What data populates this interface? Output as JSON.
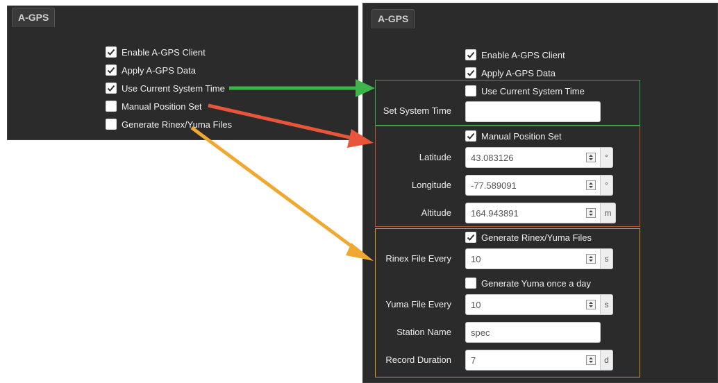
{
  "left_panel": {
    "tab": "A-GPS",
    "checkboxes": [
      {
        "label": "Enable A-GPS Client",
        "checked": true
      },
      {
        "label": "Apply A-GPS Data",
        "checked": true
      },
      {
        "label": "Use Current System Time",
        "checked": true
      },
      {
        "label": "Manual Position Set",
        "checked": false
      },
      {
        "label": "Generate Rinex/Yuma Files",
        "checked": false
      }
    ]
  },
  "right_panel": {
    "tab": "A-GPS",
    "enable_client": {
      "label": "Enable A-GPS Client",
      "checked": true
    },
    "apply_data": {
      "label": "Apply A-GPS Data",
      "checked": true
    },
    "time_group": {
      "use_current_time": {
        "label": "Use Current System Time",
        "checked": false
      },
      "set_system_time": {
        "label": "Set System Time",
        "value": ""
      }
    },
    "position_group": {
      "manual_position": {
        "label": "Manual Position Set",
        "checked": true
      },
      "latitude": {
        "label": "Latitude",
        "value": "43.083126",
        "unit": "°"
      },
      "longitude": {
        "label": "Longitude",
        "value": "-77.589091",
        "unit": "°"
      },
      "altitude": {
        "label": "Altitude",
        "value": "164.943891",
        "unit": "m"
      }
    },
    "rinex_group": {
      "generate_files": {
        "label": "Generate Rinex/Yuma Files",
        "checked": true
      },
      "rinex_every": {
        "label": "Rinex File Every",
        "value": "10",
        "unit": "s"
      },
      "yuma_once": {
        "label": "Generate Yuma once a day",
        "checked": false
      },
      "yuma_every": {
        "label": "Yuma File Every",
        "value": "10",
        "unit": "s"
      },
      "station_name": {
        "label": "Station Name",
        "value": "spec"
      },
      "record_duration": {
        "label": "Record Duration",
        "value": "7",
        "unit": "d"
      }
    }
  },
  "colors": {
    "time_group": "#3aa84a",
    "position_group": "#c0532f",
    "rinex_group": "#d9962a",
    "arrow_green": "#3db54a",
    "arrow_red": "#e8553a",
    "arrow_orange": "#f0a830"
  }
}
